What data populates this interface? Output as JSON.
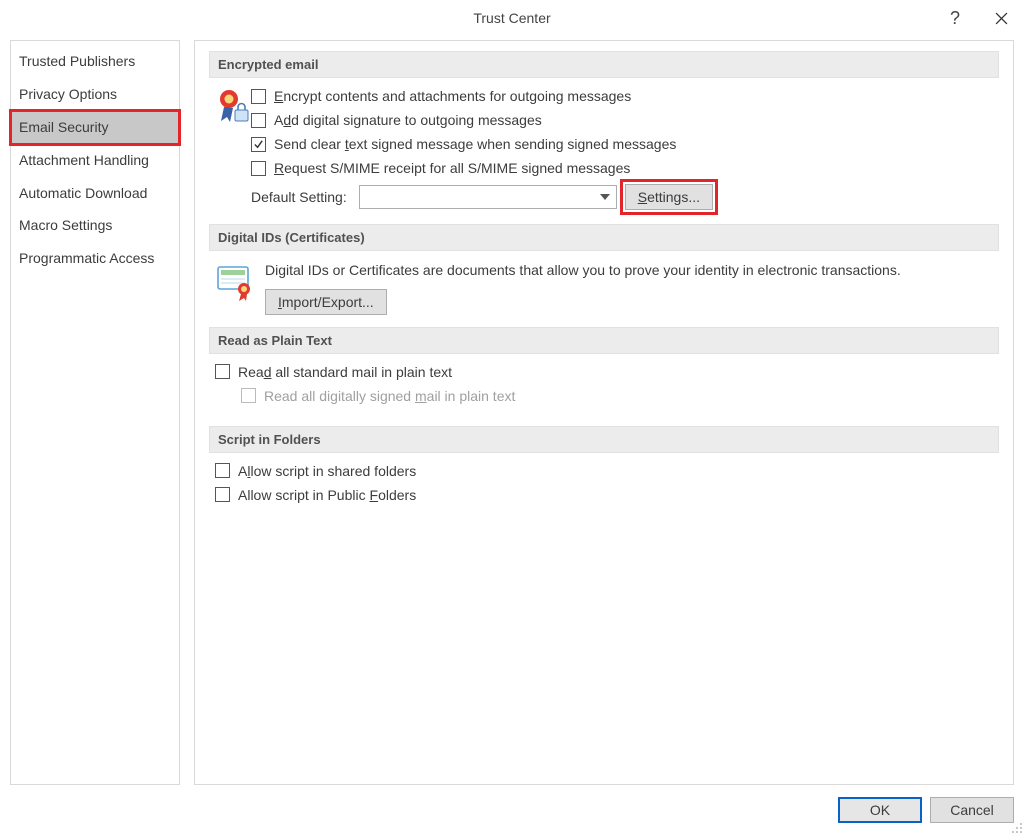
{
  "window": {
    "title": "Trust Center"
  },
  "sidebar": {
    "items": [
      {
        "label": "Trusted Publishers"
      },
      {
        "label": "Privacy Options"
      },
      {
        "label": "Email Security"
      },
      {
        "label": "Attachment Handling"
      },
      {
        "label": "Automatic Download"
      },
      {
        "label": "Macro Settings"
      },
      {
        "label": "Programmatic Access"
      }
    ],
    "selected_index": 2,
    "highlighted_index": 2
  },
  "sections": {
    "encrypted_email": {
      "title": "Encrypted email",
      "items": {
        "encrypt_contents": {
          "pre": "",
          "accel": "E",
          "post": "ncrypt contents and attachments for outgoing messages",
          "checked": false
        },
        "add_signature": {
          "pre": "A",
          "accel": "d",
          "post": "d digital signature to outgoing messages",
          "checked": false
        },
        "send_clear": {
          "pre": "Send clear ",
          "accel": "t",
          "post": "ext signed message when sending signed messages",
          "checked": true
        },
        "request_receipt": {
          "pre": "",
          "accel": "R",
          "post": "equest S/MIME receipt for all S/MIME signed messages",
          "checked": false
        },
        "default_label": "Default Setting:",
        "default_value": "",
        "settings_button": {
          "pre": "",
          "accel": "S",
          "post": "ettings..."
        }
      }
    },
    "digital_ids": {
      "title": "Digital IDs (Certificates)",
      "description": "Digital IDs or Certificates are documents that allow you to prove your identity in electronic transactions.",
      "import_button": {
        "pre": "",
        "accel": "I",
        "post": "mport/Export..."
      }
    },
    "plain_text": {
      "title": "Read as Plain Text",
      "read_all": {
        "pre": "Rea",
        "accel": "d",
        "post": " all standard mail in plain text",
        "checked": false
      },
      "read_signed": {
        "pre": "Read all digitally signed ",
        "accel": "m",
        "post": "ail in plain text",
        "checked": false,
        "disabled": true
      }
    },
    "script": {
      "title": "Script in Folders",
      "shared": {
        "pre": "A",
        "accel": "l",
        "post": "low script in shared folders",
        "checked": false
      },
      "public": {
        "pre": "Allow script in Public ",
        "accel": "F",
        "post": "olders",
        "checked": false
      }
    }
  },
  "footer": {
    "ok": "OK",
    "cancel": "Cancel"
  }
}
